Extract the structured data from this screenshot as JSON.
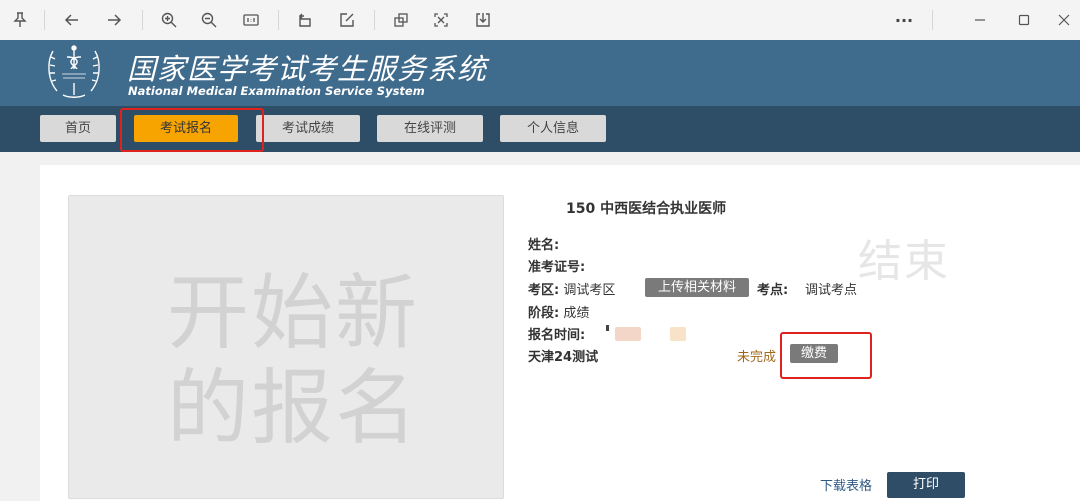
{
  "colors": {
    "header_bg": "#3f6b8d",
    "nav_bg": "#2e4e67",
    "active_tab": "#f7a400",
    "tab_bg": "#d9d9d9",
    "highlight": "#e0221e",
    "pay_status": "#a0681e",
    "print_bg": "#2f4d66"
  },
  "toolbar": {
    "icons": [
      "pin-icon",
      "back-arrow-icon",
      "forward-arrow-icon",
      "zoom-in-icon",
      "zoom-out-icon",
      "actual-size-icon",
      "rotate-icon",
      "edit-icon",
      "crop-icon",
      "fit-screen-icon",
      "save-icon",
      "more-icon",
      "minimize-icon",
      "maximize-icon",
      "close-icon"
    ],
    "more_label": "···"
  },
  "header": {
    "title": "国家医学考试考生服务系统",
    "subtitle": "National Medical Examination Service System",
    "logo_icon": "medical-caduceus-logo-icon"
  },
  "nav": {
    "tabs": [
      {
        "label": "首页"
      },
      {
        "label": "考试报名",
        "active": true
      },
      {
        "label": "考试成绩"
      },
      {
        "label": "在线评测"
      },
      {
        "label": "个人信息"
      }
    ]
  },
  "registration": {
    "new_label_line1": "开始新",
    "new_label_line2": "的报名",
    "exam_title": "150 中西医结合执业医师",
    "status_watermark": "结束",
    "name_label": "姓名:",
    "ticket_label": "准考证号:",
    "district_label": "考区:",
    "district_value": "调试考区",
    "upload_label": "上传相关材料",
    "site_label": "考点:",
    "site_value": "调试考点",
    "stage_label": "阶段:",
    "stage_value": "成绩",
    "time_label": "报名时间:",
    "fee_item": "天津24测试",
    "pay_status": "未完成",
    "pay_label": "缴费",
    "download_label": "下载表格",
    "print_label": "打印"
  }
}
